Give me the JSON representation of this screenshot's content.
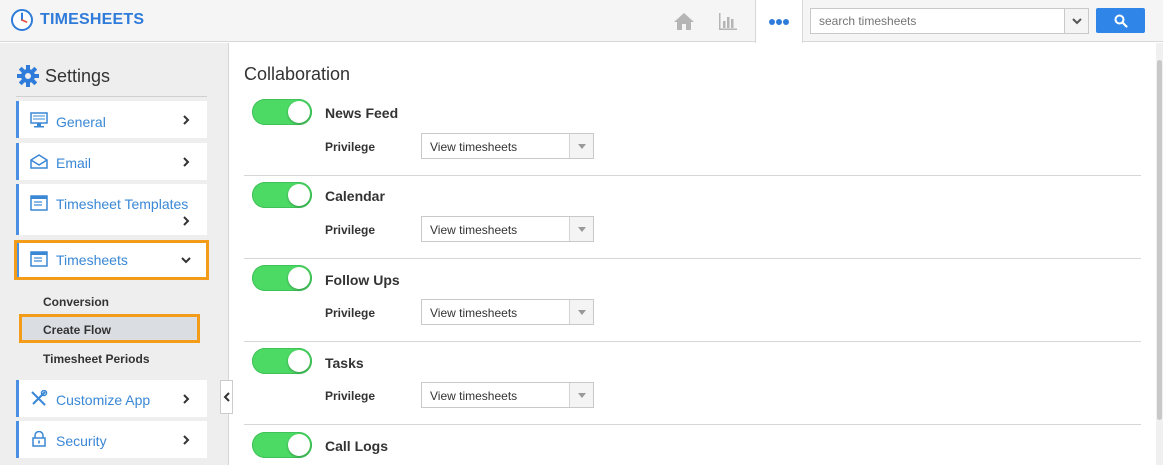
{
  "app": {
    "title": "TIMESHEETS",
    "brand_color": "#2f7bd9"
  },
  "topbar": {
    "icons": [
      "home-icon",
      "stats-icon",
      "more-icon"
    ],
    "search": {
      "placeholder": "search timesheets",
      "button_icon": "search-icon"
    }
  },
  "sidebar": {
    "title": "Settings",
    "items": [
      {
        "label": "General",
        "icon": "monitor-icon"
      },
      {
        "label": "Email",
        "icon": "envelope-icon"
      },
      {
        "label": "Timesheet Templates",
        "icon": "template-icon"
      },
      {
        "label": "Timesheets",
        "icon": "template-icon",
        "expanded": true
      },
      {
        "label": "Customize App",
        "icon": "tools-icon"
      },
      {
        "label": "Security",
        "icon": "lock-icon"
      }
    ],
    "subitems": [
      {
        "label": "Conversion"
      },
      {
        "label": "Create Flow",
        "active": true
      },
      {
        "label": "Timesheet Periods"
      }
    ],
    "highlight_color": "#f39c1a"
  },
  "main": {
    "title": "Collaboration",
    "privilege_label": "Privilege",
    "rows": [
      {
        "title": "News Feed",
        "enabled": true,
        "privilege": "View timesheets"
      },
      {
        "title": "Calendar",
        "enabled": true,
        "privilege": "View timesheets"
      },
      {
        "title": "Follow Ups",
        "enabled": true,
        "privilege": "View timesheets"
      },
      {
        "title": "Tasks",
        "enabled": true,
        "privilege": "View timesheets"
      },
      {
        "title": "Call Logs",
        "enabled": true
      }
    ],
    "toggle_color": "#4cd964"
  }
}
